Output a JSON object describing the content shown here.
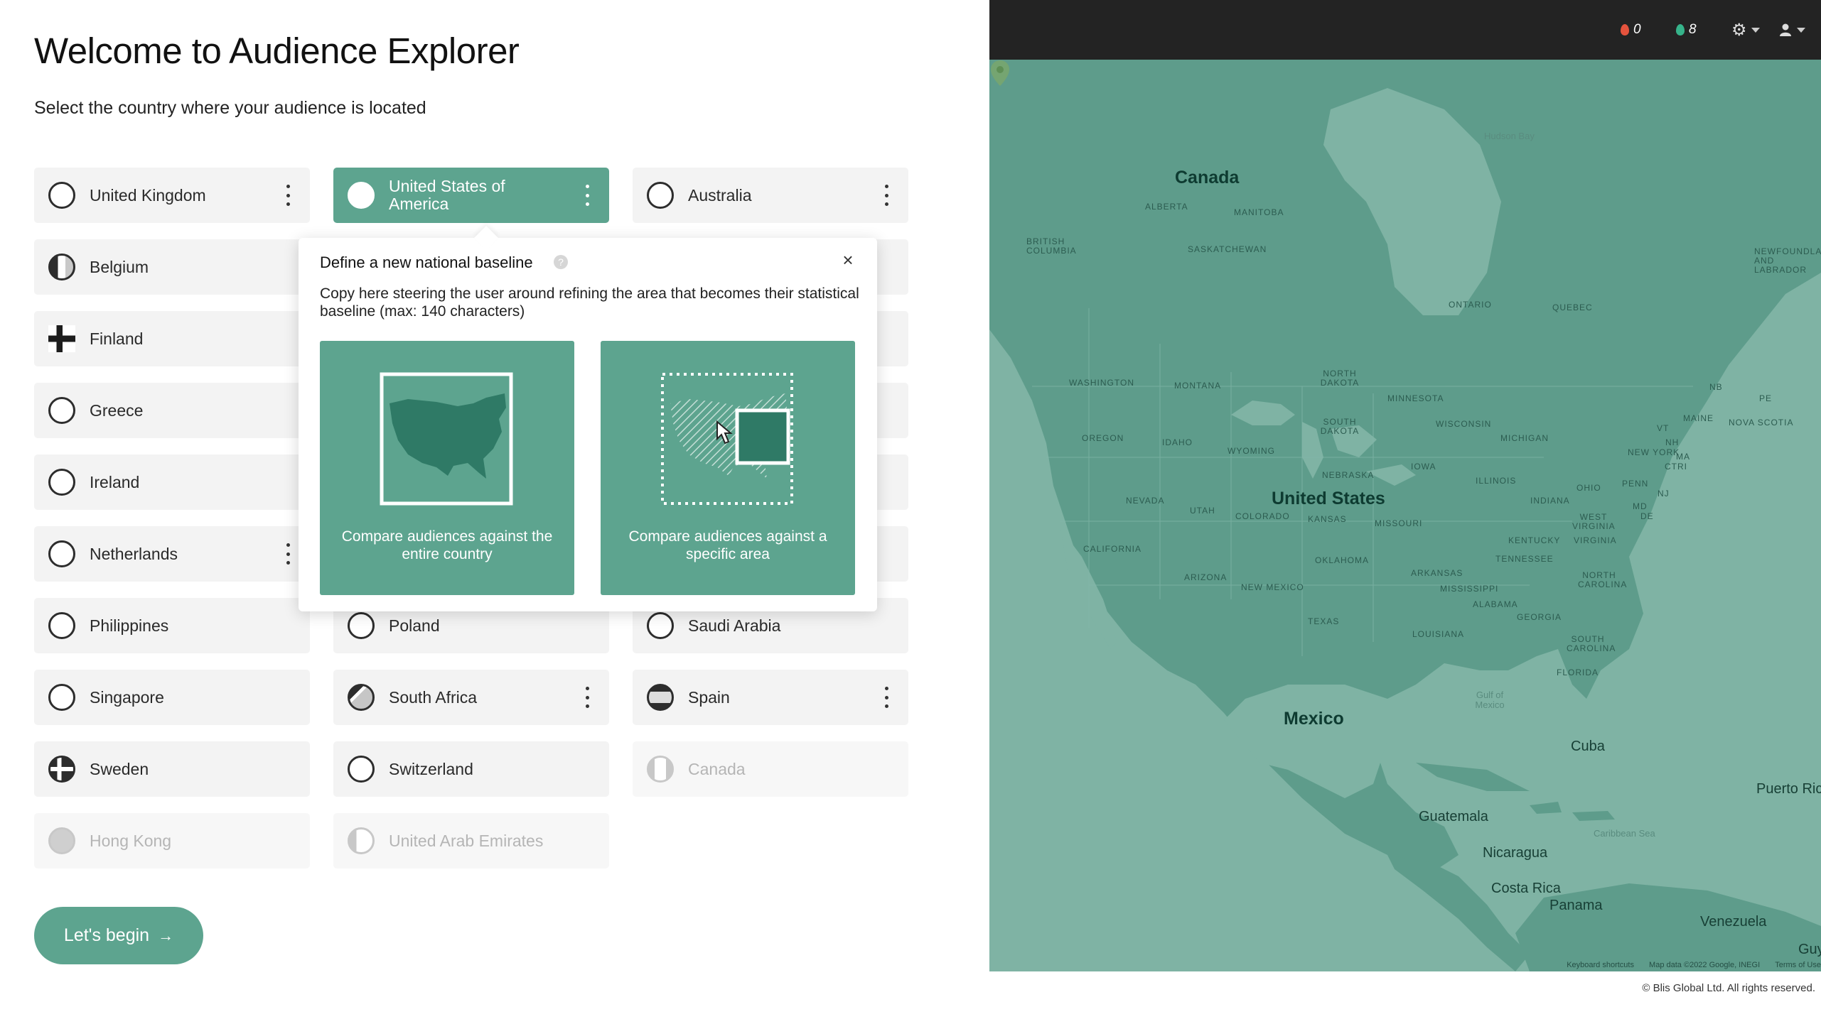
{
  "page": {
    "title": "Welcome to Audience Explorer",
    "subtitle": "Select the country where your audience is located",
    "cta_label": "Let's begin",
    "cta_arrow": "→"
  },
  "countries": [
    {
      "label": "United Kingdom",
      "flag": "uk-flag-icon"
    },
    {
      "label": "United States of America",
      "flag": "us-flag-icon",
      "selected": true
    },
    {
      "label": "Australia",
      "flag": "australia-flag-icon"
    },
    {
      "label": "Belgium",
      "flag": "belgium-flag-icon"
    },
    {
      "label": "Finland",
      "flag": "finland-flag-icon"
    },
    {
      "label": "Greece",
      "flag": "greece-flag-icon"
    },
    {
      "label": "Ireland",
      "flag": "ireland-flag-icon"
    },
    {
      "label": "Netherlands",
      "flag": "netherlands-flag-icon"
    },
    {
      "label": "Philippines",
      "flag": "philippines-flag-icon"
    },
    {
      "label": "Poland",
      "flag": "poland-flag-icon"
    },
    {
      "label": "Saudi Arabia",
      "flag": "saudi-arabia-flag-icon"
    },
    {
      "label": "Singapore",
      "flag": "singapore-flag-icon"
    },
    {
      "label": "South Africa",
      "flag": "south-africa-flag-icon"
    },
    {
      "label": "Spain",
      "flag": "spain-flag-icon"
    },
    {
      "label": "Sweden",
      "flag": "sweden-flag-icon"
    },
    {
      "label": "Switzerland",
      "flag": "switzerland-flag-icon"
    },
    {
      "label": "Canada",
      "flag": "canada-flag-icon",
      "disabled": true
    },
    {
      "label": "Hong Kong",
      "flag": "hong-kong-flag-icon",
      "disabled": true
    },
    {
      "label": "United Arab Emirates",
      "flag": "uae-flag-icon",
      "disabled": true
    }
  ],
  "popover": {
    "title": "Define a new national baseline",
    "help": "?",
    "close": "×",
    "description": "Copy here steering the user around refining the area that becomes their statistical baseline (max: 140 characters)",
    "options": [
      {
        "label": "Compare audiences against the entire country",
        "icon": "entire-country-map-icon"
      },
      {
        "label": "Compare audiences against a specific area",
        "icon": "specific-area-map-icon"
      }
    ]
  },
  "topbar": {
    "notif_red_count": "0",
    "notif_green_count": "8",
    "icons": [
      "red-drop-icon",
      "green-drop-icon",
      "gear-icon",
      "user-icon"
    ]
  },
  "map": {
    "countries": [
      "Canada",
      "United States",
      "Mexico"
    ],
    "places": [
      "Cuba",
      "Guatemala",
      "Nicaragua",
      "Costa Rica",
      "Panama",
      "Venezuela",
      "Puerto Rico",
      "Guy"
    ],
    "regions": [
      "ALBERTA",
      "MANITOBA",
      "BRITISH COLUMBIA",
      "SASKATCHEWAN",
      "ONTARIO",
      "QUEBEC",
      "NEWFOUNDLAND AND LABRADOR",
      "WASHINGTON",
      "MONTANA",
      "NORTH DAKOTA",
      "MINNESOTA",
      "OREGON",
      "IDAHO",
      "WYOMING",
      "SOUTH DAKOTA",
      "WISCONSIN",
      "MICHIGAN",
      "NEW YORK",
      "NEBRASKA",
      "IOWA",
      "NEVADA",
      "UTAH",
      "COLORADO",
      "KANSAS",
      "MISSOURI",
      "ILLINOIS",
      "INDIANA",
      "OHIO",
      "PENN",
      "CALIFORNIA",
      "ARIZONA",
      "NEW MEXICO",
      "OKLAHOMA",
      "ARKANSAS",
      "TENNESSEE",
      "KENTUCKY",
      "VIRGINIA",
      "WEST VIRGINIA",
      "NORTH CAROLINA",
      "SOUTH CAROLINA",
      "MISSISSIPPI",
      "ALABAMA",
      "GEORGIA",
      "TEXAS",
      "LOUISIANA",
      "FLORIDA",
      "MAINE",
      "NOVA SCOTIA",
      "NB",
      "PE",
      "VT",
      "NH",
      "MA",
      "CT",
      "RI",
      "MD",
      "DE",
      "NJ"
    ],
    "seas": [
      "Hudson Bay",
      "Gulf of Mexico",
      "Caribbean Sea"
    ],
    "footer": {
      "shortcuts": "Keyboard shortcuts",
      "mapdata": "Map data ©2022 Google, INEGI",
      "terms": "Terms of Use"
    }
  },
  "copyright": "© Blis Global Ltd. All rights reserved.",
  "colors": {
    "accent": "#5da48f",
    "map_land": "#5e9c8b",
    "map_water": "#7fb3a4",
    "topbar": "#232323"
  }
}
